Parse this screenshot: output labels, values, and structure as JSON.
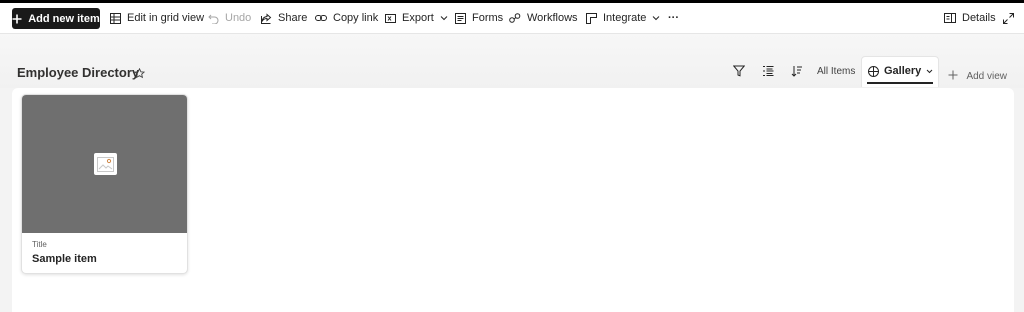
{
  "commandbar": {
    "add_new_item": "Add new item",
    "edit_grid": "Edit in grid view",
    "undo": "Undo",
    "share": "Share",
    "copy_link": "Copy link",
    "export": "Export",
    "forms": "Forms",
    "workflows": "Workflows",
    "integrate": "Integrate",
    "more": "···",
    "details": "Details"
  },
  "header": {
    "title": "Employee Directory"
  },
  "views": {
    "all_items": "All Items",
    "gallery": "Gallery",
    "add_view": "Add view"
  },
  "cards": [
    {
      "field_label": "Title",
      "title": "Sample item"
    }
  ],
  "colors": {
    "primary_button": "#1a1a1a",
    "card_image": "#6f6f6f"
  }
}
